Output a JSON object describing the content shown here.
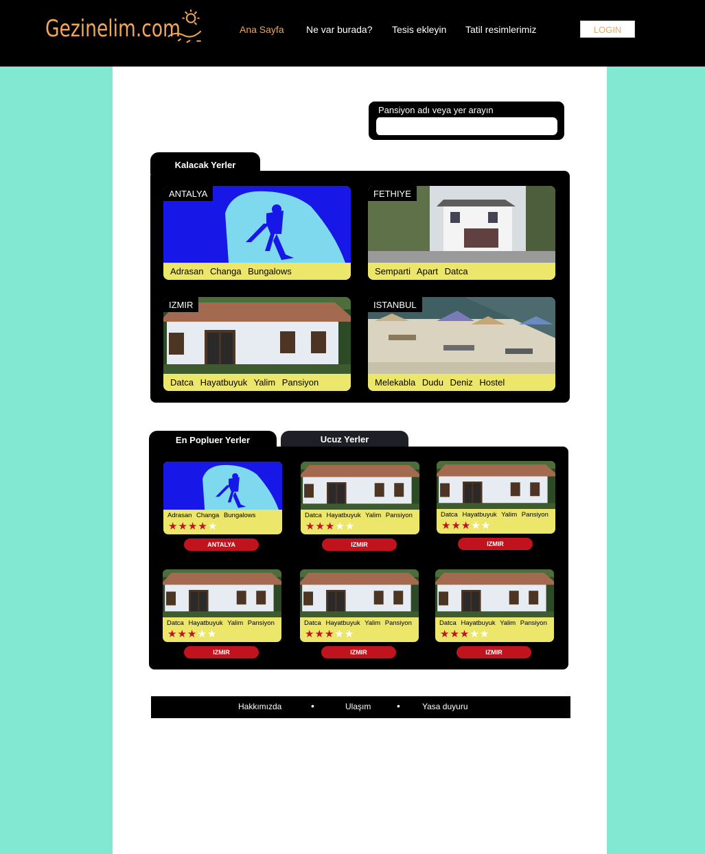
{
  "brand": {
    "logo_text": "Gezinelim.com"
  },
  "nav": {
    "items": [
      {
        "label": "Ana Sayfa",
        "active": true
      },
      {
        "label": "Ne var burada?"
      },
      {
        "label": "Tesis ekleyin"
      },
      {
        "label": "Tatil resimlerimiz"
      }
    ],
    "login_label": "LOGIN"
  },
  "search": {
    "label": "Pansiyon adı veya yer arayın",
    "value": "",
    "placeholder": ""
  },
  "stay": {
    "tab_label": "Kalacak Yerler",
    "cards": [
      {
        "city": "ANTALYA",
        "caption": "Adrasan Changa Bungalows",
        "image": "diver-cave-icon"
      },
      {
        "city": "FETHIYE",
        "caption": "Semparti Apart Datca",
        "image": "villa-photo-icon"
      },
      {
        "city": "IZMIR",
        "caption": "Datca Hayatbuyuk Yalim Pansiyon",
        "image": "house-photo-icon"
      },
      {
        "city": "ISTANBUL",
        "caption": "Melekabla Dudu Deniz Hostel",
        "image": "beach-photo-icon"
      }
    ]
  },
  "popular": {
    "tabs": [
      {
        "label": "En Popluer Yerler",
        "active": true
      },
      {
        "label": "Ucuz Yerler"
      }
    ],
    "items": [
      {
        "caption": "Adrasan Changa Bungalows",
        "rating": 4,
        "button": "ANTALYA",
        "image": "diver-cave-icon"
      },
      {
        "caption": "Datca Hayatbuyuk Yalim Pansiyon",
        "rating": 3,
        "button": "IZMIR",
        "image": "house-photo-icon"
      },
      {
        "caption": "Datca Hayatbuyuk Yalim Pansiyon",
        "rating": 3,
        "button": "IZMIR",
        "image": "house-photo-icon"
      },
      {
        "caption": "Datca Hayatbuyuk Yalim Pansiyon",
        "rating": 3,
        "button": "IZMIR",
        "image": "house-photo-icon"
      },
      {
        "caption": "Datca Hayatbuyuk Yalim Pansiyon",
        "rating": 3,
        "button": "IZMIR",
        "image": "house-photo-icon"
      },
      {
        "caption": "Datca Hayatbuyuk Yalim Pansiyon",
        "rating": 3,
        "button": "IZMIR",
        "image": "house-photo-icon"
      }
    ],
    "max_rating": 5
  },
  "footer": {
    "links": [
      "Hakkımızda",
      "Ulaşım",
      "Yasa duyuru"
    ]
  },
  "colors": {
    "accent": "#f0a75a",
    "background": "#83e8d1",
    "caption_bar": "#ece66a",
    "button": "#c0131d"
  }
}
